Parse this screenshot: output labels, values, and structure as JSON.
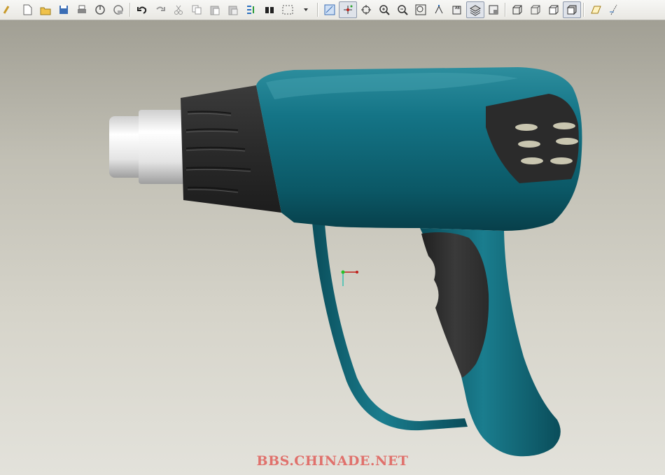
{
  "toolbar": {
    "groups": [
      [
        "edge-icon",
        "new-file-icon",
        "open-folder-icon",
        "save-icon",
        "print-icon",
        "send-mail-icon",
        "mail-attachment-icon"
      ],
      [
        "undo-icon",
        "redo-icon",
        "cut-icon",
        "copy-icon",
        "paste-icon",
        "paste-special-icon",
        "regenerate-icon",
        "find-icon",
        "selection-box-icon",
        "dropdown-arrow-icon"
      ],
      [
        "repaint-icon",
        "spin-center-icon",
        "orient-mode-icon",
        "zoom-in-icon",
        "zoom-out-icon",
        "refit-icon",
        "reorient-icon",
        "saved-views-icon",
        "layers-icon",
        "view-manager-icon"
      ],
      [
        "wireframe-icon",
        "hidden-line-icon",
        "no-hidden-icon",
        "shading-icon"
      ],
      [
        "datum-plane-icon",
        "datum-axis-icon"
      ]
    ],
    "active_icons": [
      "spin-center-icon",
      "layers-icon",
      "shading-icon"
    ]
  },
  "model": {
    "body_color": "#0e6272",
    "grip_color": "#353535",
    "nozzle_color": "#e6e6e6"
  },
  "watermark": "BBS.CHINADE.NET"
}
